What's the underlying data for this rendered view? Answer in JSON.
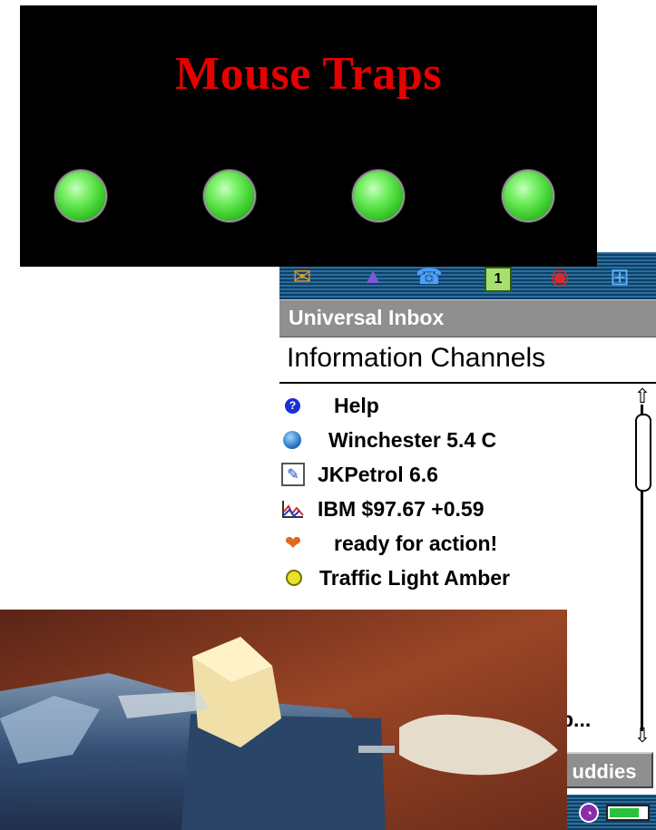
{
  "banner": {
    "title": "Mouse Traps",
    "dots": 4
  },
  "toolbar": {
    "icons": [
      "mail-icon",
      "address-book-icon",
      "phone-icon",
      "calendar-icon",
      "security-icon",
      "applications-grid-icon"
    ],
    "calendar_day": "1"
  },
  "app": {
    "title": "Universal Inbox"
  },
  "section": {
    "title": "Information Channels"
  },
  "channels": [
    {
      "icon": "help-icon",
      "label": "Help"
    },
    {
      "icon": "globe-icon",
      "label": "Winchester 5.4 C"
    },
    {
      "icon": "notepad-icon",
      "label": "JKPetrol  6.6"
    },
    {
      "icon": "stock-chart-icon",
      "label": "IBM  $97.67 +0.59"
    },
    {
      "icon": "fox-icon",
      "label": "ready for action!"
    },
    {
      "icon": "traffic-light-icon",
      "label": "Traffic Light  Amber"
    }
  ],
  "partial_text": "p...",
  "buddies_button": {
    "label": "uddies"
  },
  "status_bar": {
    "icons": [
      "clock-icon",
      "battery-icon"
    ],
    "battery_level": 0.8
  },
  "photo": {
    "subject": "mouse-trap-photo"
  },
  "colors": {
    "banner_title": "#e60000",
    "dot": "#3fd12f",
    "header": "#8f8f8f",
    "toolbar": "#0f3e66"
  }
}
